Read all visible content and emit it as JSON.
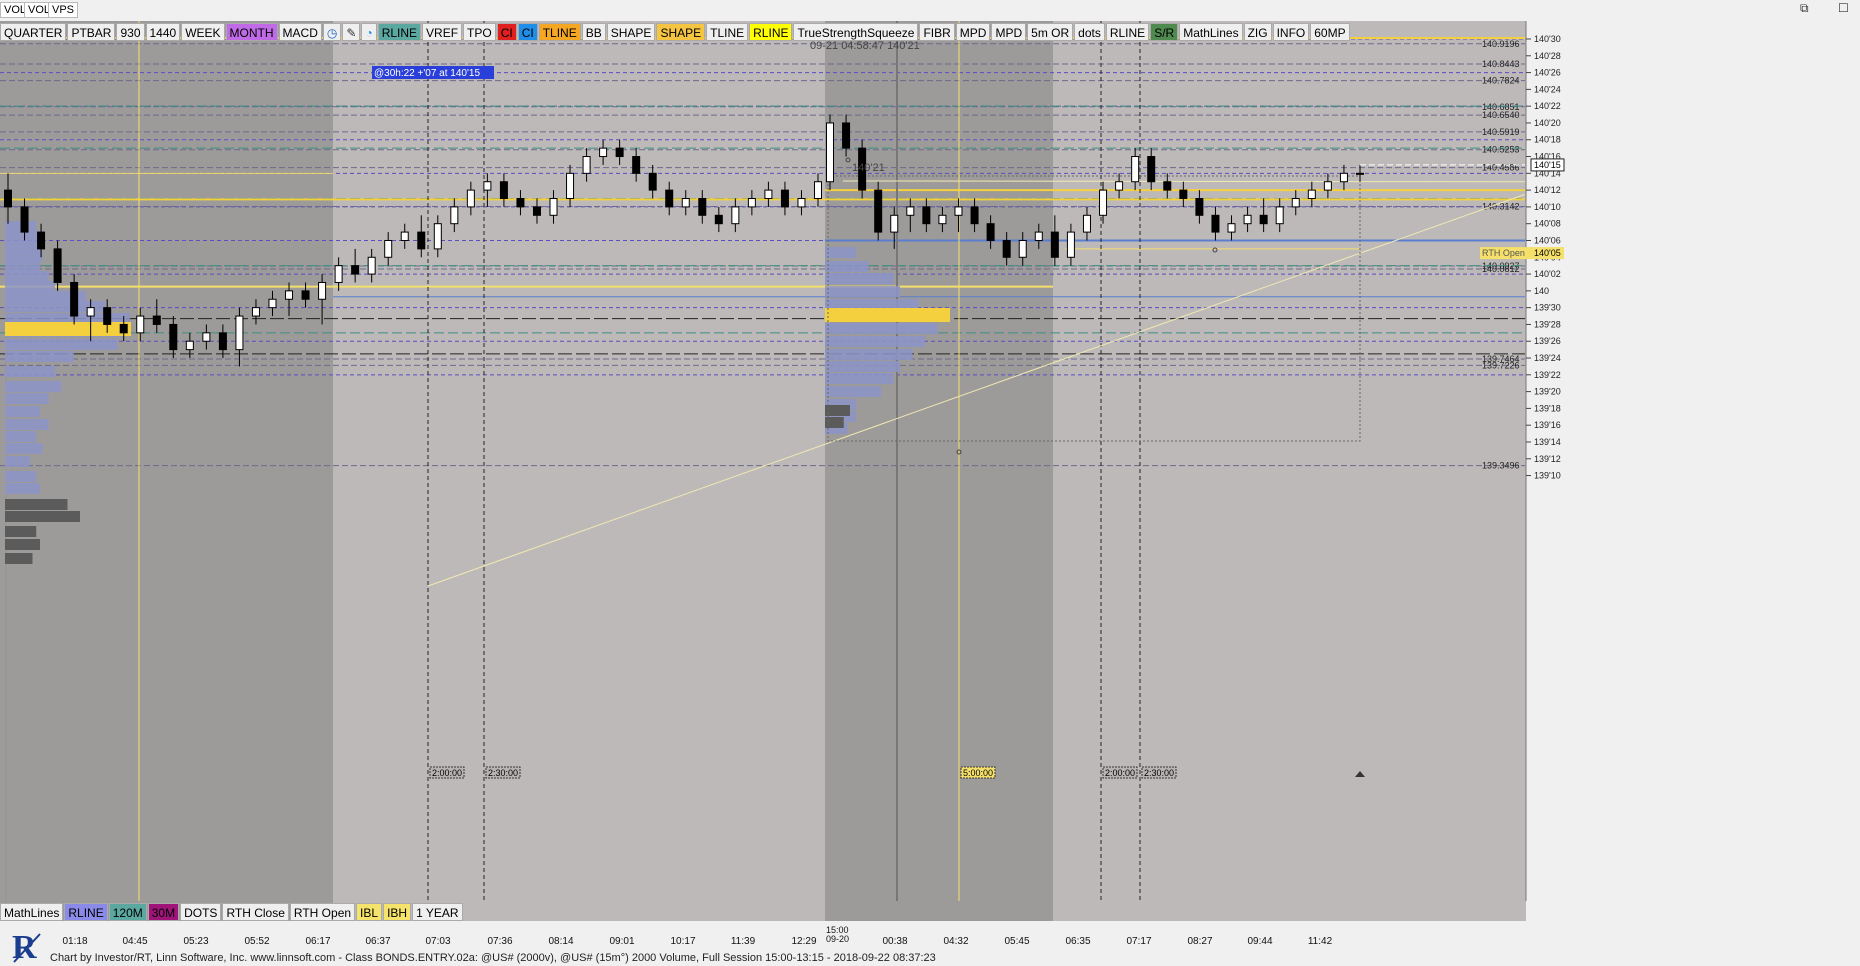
{
  "window": {
    "tabs": [
      "VOL",
      "VOL",
      "VPS"
    ],
    "controls": [
      "⧉",
      "☐"
    ]
  },
  "toolbar": {
    "buttons": [
      {
        "label": "QUARTER",
        "bg": "#efefef",
        "fg": "#000"
      },
      {
        "label": "PTBAR",
        "bg": "#efefef",
        "fg": "#000"
      },
      {
        "label": "930",
        "bg": "#efefef",
        "fg": "#000"
      },
      {
        "label": "1440",
        "bg": "#efefef",
        "fg": "#000"
      },
      {
        "label": "WEEK",
        "bg": "#efefef",
        "fg": "#000"
      },
      {
        "label": "MONTH",
        "bg": "#c06ae8",
        "fg": "#000"
      },
      {
        "label": "MACD",
        "bg": "#efefef",
        "fg": "#000"
      },
      {
        "label": "◷",
        "bg": "#efefef",
        "fg": "#1c5fbf"
      },
      {
        "label": "✎",
        "bg": "#efefef",
        "fg": "#333"
      },
      {
        "label": "◔",
        "bg": "#efefef",
        "fg": "#1c8cd8"
      },
      {
        "label": "RLINE",
        "bg": "#5aa8a0",
        "fg": "#000"
      },
      {
        "label": "VREF",
        "bg": "#efefef",
        "fg": "#000"
      },
      {
        "label": "TPO",
        "bg": "#efefef",
        "fg": "#000"
      },
      {
        "label": "CI",
        "bg": "#e02020",
        "fg": "#000"
      },
      {
        "label": "CI",
        "bg": "#1f8ee8",
        "fg": "#000"
      },
      {
        "label": "TLINE",
        "bg": "#f5a623",
        "fg": "#000"
      },
      {
        "label": "BB",
        "bg": "#efefef",
        "fg": "#000"
      },
      {
        "label": "SHAPE",
        "bg": "#efefef",
        "fg": "#000"
      },
      {
        "label": "SHAPE",
        "bg": "#f5c542",
        "fg": "#000"
      },
      {
        "label": "TLINE",
        "bg": "#efefef",
        "fg": "#000"
      },
      {
        "label": "RLINE",
        "bg": "#ffff00",
        "fg": "#000"
      },
      {
        "label": "TrueStrengthSqueeze",
        "bg": "#efefef",
        "fg": "#000"
      },
      {
        "label": "FIBR",
        "bg": "#efefef",
        "fg": "#000"
      },
      {
        "label": "MPD",
        "bg": "#efefef",
        "fg": "#000"
      },
      {
        "label": "MPD",
        "bg": "#efefef",
        "fg": "#000"
      },
      {
        "label": "5m OR",
        "bg": "#efefef",
        "fg": "#000"
      },
      {
        "label": "dots",
        "bg": "#efefef",
        "fg": "#000"
      },
      {
        "label": "RLINE",
        "bg": "#efefef",
        "fg": "#000"
      },
      {
        "label": "S/R",
        "bg": "#4f8a4f",
        "fg": "#000"
      },
      {
        "label": "MathLines",
        "bg": "#efefef",
        "fg": "#000"
      },
      {
        "label": "ZIG",
        "bg": "#efefef",
        "fg": "#000"
      },
      {
        "label": "INFO",
        "bg": "#efefef",
        "fg": "#000"
      },
      {
        "label": "60MP",
        "bg": "#efefef",
        "fg": "#000"
      }
    ]
  },
  "bottombar": {
    "buttons": [
      {
        "label": "MathLines",
        "bg": "#efefef",
        "fg": "#000"
      },
      {
        "label": "RLINE",
        "bg": "#8a8ae8",
        "fg": "#000"
      },
      {
        "label": "120M",
        "bg": "#5aa8a0",
        "fg": "#000"
      },
      {
        "label": "30M",
        "bg": "#a0147a",
        "fg": "#000"
      },
      {
        "label": "DOTS",
        "bg": "#efefef",
        "fg": "#000"
      },
      {
        "label": "RTH Close",
        "bg": "#efefef",
        "fg": "#000"
      },
      {
        "label": "RTH Open",
        "bg": "#efefef",
        "fg": "#000"
      },
      {
        "label": "IBL",
        "bg": "#f5e36b",
        "fg": "#000"
      },
      {
        "label": "IBH",
        "bg": "#f5e36b",
        "fg": "#000"
      },
      {
        "label": "1 YEAR",
        "bg": "#efefef",
        "fg": "#000"
      }
    ]
  },
  "header": {
    "cursor_readout": "09-21 04:58:47  140'21",
    "measure_label": "@30h:22  +'07 at 140'15",
    "high_label": "140'21"
  },
  "chart_data": {
    "type": "candlestick",
    "instrument": "@US# (15m)",
    "y_axis": {
      "min_32nds": 4424,
      "max_32nds": 4510,
      "ticks": [
        "140'30",
        "140'28",
        "140'26",
        "140'24",
        "140'22",
        "140'20",
        "140'18",
        "140'16",
        "140'14",
        "140'12",
        "140'10",
        "140'08",
        "140'06",
        "140'04",
        "140'02",
        "140",
        "139'30",
        "139'28",
        "139'26",
        "139'24",
        "139'22",
        "139'20",
        "139'18",
        "139'16",
        "139'14",
        "139'12",
        "139'10"
      ],
      "tick_values_32nds": [
        4510,
        4508,
        4506,
        4504,
        4502,
        4500,
        4498,
        4496,
        4494,
        4492,
        4490,
        4488,
        4486,
        4484,
        4482,
        4480,
        4478,
        4476,
        4474,
        4472,
        4470,
        4468,
        4466,
        4464,
        4462,
        4460,
        4458
      ]
    },
    "x_axis": {
      "ticks": [
        "01:18",
        "04:45",
        "05:23",
        "05:52",
        "06:17",
        "06:37",
        "07:03",
        "07:36",
        "08:14",
        "09:01",
        "10:17",
        "11:39",
        "12:29",
        "15:00",
        "00:38",
        "04:32",
        "05:45",
        "06:35",
        "07:17",
        "08:27",
        "09:44",
        "11:42"
      ],
      "date_marker": {
        "time": "15:00",
        "date": "09-20"
      },
      "session_boxes": [
        "2:00:00",
        "2:30:00",
        "5:00:00",
        "2:00:00",
        "2:30:00"
      ]
    },
    "price_levels": [
      {
        "label": "140.9196",
        "value": 140.9196,
        "color": "#7a6a9a"
      },
      {
        "label": "140.8443",
        "value": 140.8443,
        "color": "#7a6a9a"
      },
      {
        "label": "140.7824",
        "value": 140.7824,
        "color": "#7a6a9a"
      },
      {
        "label": "140.6851",
        "value": 140.6851,
        "color": "#7a6a9a"
      },
      {
        "label": "140.6540",
        "value": 140.654,
        "color": "#7a6a9a"
      },
      {
        "label": "140.5919",
        "value": 140.5919,
        "color": "#7a6a9a"
      },
      {
        "label": "140.5253",
        "value": 140.5253,
        "color": "#7a6a9a"
      },
      {
        "label": "140.4586",
        "value": 140.4586,
        "color": "#7a6a9a"
      },
      {
        "label": "140.3142",
        "value": 140.3142,
        "color": "#7a6a9a"
      },
      {
        "label": "140.0927",
        "value": 140.0927,
        "color": "#7a6a9a"
      },
      {
        "label": "140.0812",
        "value": 140.0812,
        "color": "#7a6a9a"
      },
      {
        "label": "139.7464",
        "value": 139.7464,
        "color": "#7a6a9a"
      },
      {
        "label": "139.7226",
        "value": 139.7226,
        "color": "#7a6a9a"
      },
      {
        "label": "139.3496",
        "value": 139.3496,
        "color": "#7a6a9a"
      }
    ],
    "last_price": "140'15",
    "rth_open": {
      "label": "RTH Open",
      "price": "140'05"
    },
    "ohlc_32nds": [
      [
        4492,
        4494,
        4488,
        4490
      ],
      [
        4490,
        4491,
        4486,
        4487
      ],
      [
        4487,
        4488,
        4484,
        4485
      ],
      [
        4485,
        4486,
        4480,
        4481
      ],
      [
        4481,
        4482,
        4476,
        4477
      ],
      [
        4477,
        4479,
        4474,
        4478
      ],
      [
        4478,
        4479,
        4475,
        4476
      ],
      [
        4476,
        4477,
        4474,
        4475
      ],
      [
        4475,
        4478,
        4474,
        4477
      ],
      [
        4477,
        4479,
        4475,
        4476
      ],
      [
        4476,
        4477,
        4472,
        4473
      ],
      [
        4473,
        4475,
        4472,
        4474
      ],
      [
        4474,
        4476,
        4473,
        4475
      ],
      [
        4475,
        4476,
        4472,
        4473
      ],
      [
        4473,
        4478,
        4471,
        4477
      ],
      [
        4477,
        4479,
        4476,
        4478
      ],
      [
        4478,
        4480,
        4477,
        4479
      ],
      [
        4479,
        4481,
        4477,
        4480
      ],
      [
        4480,
        4481,
        4478,
        4479
      ],
      [
        4479,
        4482,
        4476,
        4481
      ],
      [
        4481,
        4484,
        4480,
        4483
      ],
      [
        4483,
        4485,
        4481,
        4482
      ],
      [
        4482,
        4485,
        4481,
        4484
      ],
      [
        4484,
        4487,
        4483,
        4486
      ],
      [
        4486,
        4488,
        4485,
        4487
      ],
      [
        4487,
        4489,
        4484,
        4485
      ],
      [
        4485,
        4489,
        4484,
        4488
      ],
      [
        4488,
        4491,
        4487,
        4490
      ],
      [
        4490,
        4493,
        4489,
        4492
      ],
      [
        4492,
        4494,
        4490,
        4493
      ],
      [
        4493,
        4494,
        4490,
        4491
      ],
      [
        4491,
        4492,
        4489,
        4490
      ],
      [
        4490,
        4491,
        4488,
        4489
      ],
      [
        4489,
        4492,
        4488,
        4491
      ],
      [
        4491,
        4495,
        4490,
        4494
      ],
      [
        4494,
        4497,
        4493,
        4496
      ],
      [
        4496,
        4498,
        4495,
        4497
      ],
      [
        4497,
        4498,
        4495,
        4496
      ],
      [
        4496,
        4497,
        4493,
        4494
      ],
      [
        4494,
        4495,
        4491,
        4492
      ],
      [
        4492,
        4493,
        4489,
        4490
      ],
      [
        4490,
        4492,
        4489,
        4491
      ],
      [
        4491,
        4492,
        4488,
        4489
      ],
      [
        4489,
        4490,
        4487,
        4488
      ],
      [
        4488,
        4491,
        4487,
        4490
      ],
      [
        4490,
        4492,
        4489,
        4491
      ],
      [
        4491,
        4493,
        4490,
        4492
      ],
      [
        4492,
        4493,
        4489,
        4490
      ],
      [
        4490,
        4492,
        4489,
        4491
      ],
      [
        4491,
        4494,
        4490,
        4493
      ],
      [
        4493,
        4501,
        4492,
        4500
      ],
      [
        4500,
        4501,
        4496,
        4497
      ],
      [
        4497,
        4498,
        4491,
        4492
      ],
      [
        4492,
        4493,
        4486,
        4487
      ],
      [
        4487,
        4490,
        4485,
        4489
      ],
      [
        4489,
        4491,
        4487,
        4490
      ],
      [
        4490,
        4491,
        4487,
        4488
      ],
      [
        4488,
        4490,
        4487,
        4489
      ],
      [
        4489,
        4491,
        4487,
        4490
      ],
      [
        4490,
        4491,
        4487,
        4488
      ],
      [
        4488,
        4489,
        4485,
        4486
      ],
      [
        4486,
        4487,
        4483,
        4484
      ],
      [
        4484,
        4487,
        4483,
        4486
      ],
      [
        4486,
        4488,
        4485,
        4487
      ],
      [
        4487,
        4489,
        4483,
        4484
      ],
      [
        4484,
        4488,
        4483,
        4487
      ],
      [
        4487,
        4490,
        4486,
        4489
      ],
      [
        4489,
        4493,
        4488,
        4492
      ],
      [
        4492,
        4494,
        4491,
        4493
      ],
      [
        4493,
        4497,
        4492,
        4496
      ],
      [
        4496,
        4497,
        4492,
        4493
      ],
      [
        4493,
        4494,
        4491,
        4492
      ],
      [
        4492,
        4493,
        4490,
        4491
      ],
      [
        4491,
        4492,
        4488,
        4489
      ],
      [
        4489,
        4490,
        4486,
        4487
      ],
      [
        4487,
        4489,
        4486,
        4488
      ],
      [
        4488,
        4490,
        4487,
        4489
      ],
      [
        4489,
        4491,
        4487,
        4488
      ],
      [
        4488,
        4491,
        4487,
        4490
      ],
      [
        4490,
        4492,
        4489,
        4491
      ],
      [
        4491,
        4493,
        4490,
        4492
      ],
      [
        4492,
        4494,
        4491,
        4493
      ],
      [
        4493,
        4495,
        4492,
        4494
      ],
      [
        4494,
        4495,
        4493,
        4494
      ]
    ]
  },
  "footer": {
    "text": "Chart by Investor/RT, Linn Software, Inc. www.linnsoft.com - Class BONDS.ENTRY.02a: @US# (2000v), @US# (15m°) 2000 Volume, Full Session 15:00-13:15 - 2018-09-22 08:37:23",
    "logo_letter": "R"
  }
}
